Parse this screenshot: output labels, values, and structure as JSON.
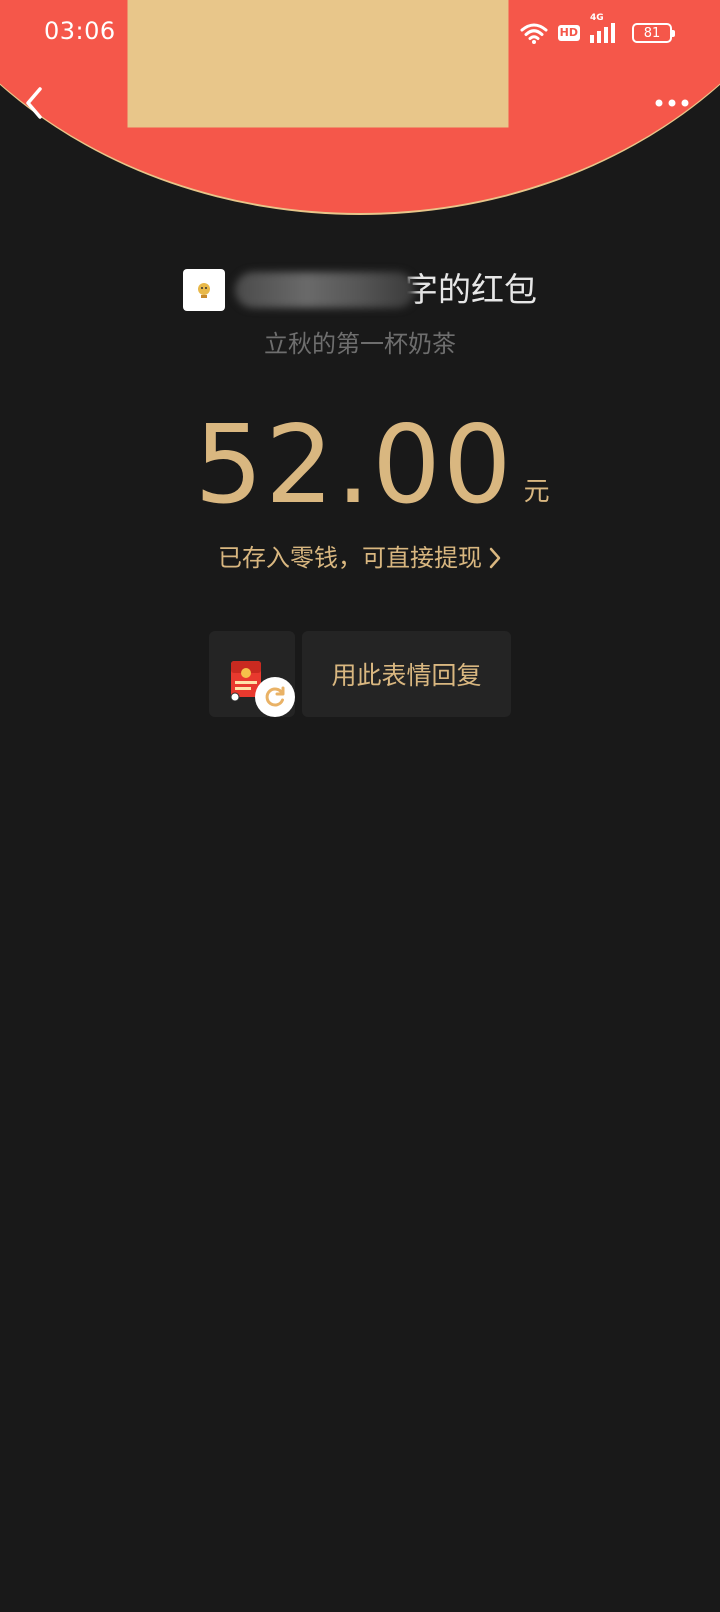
{
  "status_bar": {
    "time": "03:06",
    "hd_label": "HD",
    "network_label": "4G",
    "battery": "81"
  },
  "icons": {
    "back": "chevron-left-icon",
    "more": "more-dots-icon",
    "refresh": "refresh-icon",
    "deposit_arrow": "chevron-right-icon"
  },
  "sender": {
    "suffix": "字的红包"
  },
  "red_packet": {
    "wish": "立秋的第一杯奶茶",
    "amount": "52.00",
    "unit": "元",
    "deposit_text": "已存入零钱，可直接提现"
  },
  "reply": {
    "label": "用此表情回复"
  },
  "colors": {
    "header_red": "#f5574a",
    "gold": "#d9b780",
    "background": "#191919"
  }
}
